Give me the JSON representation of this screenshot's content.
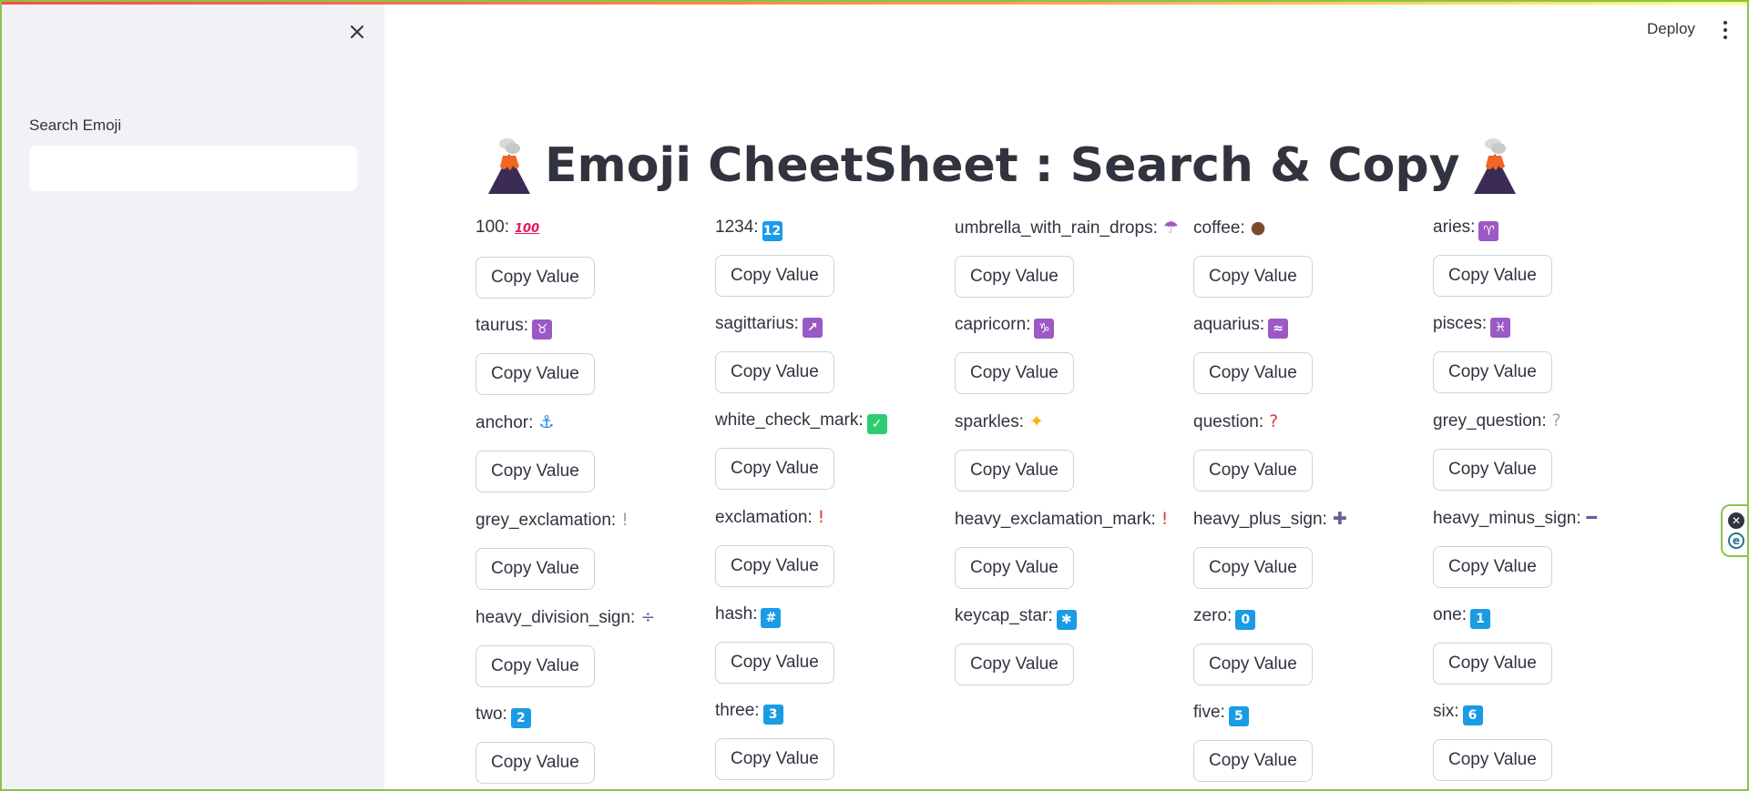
{
  "sidebar": {
    "search_label": "Search Emoji",
    "search_value": "",
    "search_placeholder": ""
  },
  "header": {
    "deploy_label": "Deploy"
  },
  "title": {
    "text": "Emoji CheetSheet : Search & Copy",
    "icon": "volcano-icon"
  },
  "copy_label": "Copy Value",
  "columns": [
    [
      {
        "name": "100:",
        "emoji": "💯",
        "emoji_text": "100",
        "icon": "hundred-points-icon",
        "color": "#e8175d",
        "style": "text"
      },
      {
        "name": "taurus:",
        "emoji": "♉",
        "emoji_text": "♉",
        "icon": "taurus-icon",
        "color": "#9b59c6",
        "style": "box"
      },
      {
        "name": "anchor:",
        "emoji": "⚓",
        "emoji_text": "⚓",
        "icon": "anchor-icon",
        "color": "#1e88e5",
        "style": "plain"
      },
      {
        "name": "grey_exclamation:",
        "emoji": "❕",
        "emoji_text": "!",
        "icon": "grey-exclamation-icon",
        "color": "#a0a4ab",
        "style": "plain"
      },
      {
        "name": "heavy_division_sign:",
        "emoji": "➗",
        "emoji_text": "÷",
        "icon": "division-sign-icon",
        "color": "#6a5b9a",
        "style": "plain"
      },
      {
        "name": "two:",
        "emoji": "2️⃣",
        "emoji_text": "2",
        "icon": "keycap-two-icon",
        "color": "#1a9be6",
        "style": "box"
      }
    ],
    [
      {
        "name": "1234:",
        "emoji": "🔢",
        "emoji_text": "12",
        "icon": "input-numbers-icon",
        "color": "#1a9be6",
        "style": "box"
      },
      {
        "name": "sagittarius:",
        "emoji": "♐",
        "emoji_text": "↗",
        "icon": "sagittarius-icon",
        "color": "#9b59c6",
        "style": "box"
      },
      {
        "name": "white_check_mark:",
        "emoji": "✅",
        "emoji_text": "✓",
        "icon": "check-mark-icon",
        "color": "#2ecc71",
        "style": "box"
      },
      {
        "name": "exclamation:",
        "emoji": "❗",
        "emoji_text": "!",
        "icon": "exclamation-icon",
        "color": "#e53935",
        "style": "plain"
      },
      {
        "name": "hash:",
        "emoji": "#️⃣",
        "emoji_text": "#",
        "icon": "keycap-hash-icon",
        "color": "#1a9be6",
        "style": "box"
      },
      {
        "name": "three:",
        "emoji": "3️⃣",
        "emoji_text": "3",
        "icon": "keycap-three-icon",
        "color": "#1a9be6",
        "style": "box"
      }
    ],
    [
      {
        "name": "umbrella_with_rain_drops:",
        "emoji": "☔",
        "emoji_text": "☂",
        "icon": "umbrella-rain-icon",
        "color": "#9b59c6",
        "style": "plain"
      },
      {
        "name": "capricorn:",
        "emoji": "♑",
        "emoji_text": "♑",
        "icon": "capricorn-icon",
        "color": "#9b59c6",
        "style": "box"
      },
      {
        "name": "sparkles:",
        "emoji": "✨",
        "emoji_text": "✦",
        "icon": "sparkles-icon",
        "color": "#f5b400",
        "style": "plain"
      },
      {
        "name": "heavy_exclamation_mark:",
        "emoji": "❗",
        "emoji_text": "!",
        "icon": "heavy-exclamation-icon",
        "color": "#e53935",
        "style": "plain"
      },
      {
        "name": "keycap_star:",
        "emoji": "*️⃣",
        "emoji_text": "✱",
        "icon": "keycap-star-icon",
        "color": "#1a9be6",
        "style": "box"
      }
    ],
    [
      {
        "name": "coffee:",
        "emoji": "☕",
        "emoji_text": "●",
        "icon": "coffee-icon",
        "color": "#7b4a2d",
        "style": "plain"
      },
      {
        "name": "aquarius:",
        "emoji": "♒",
        "emoji_text": "≈",
        "icon": "aquarius-icon",
        "color": "#9b59c6",
        "style": "box"
      },
      {
        "name": "question:",
        "emoji": "❓",
        "emoji_text": "?",
        "icon": "question-icon",
        "color": "#e53935",
        "style": "plain"
      },
      {
        "name": "heavy_plus_sign:",
        "emoji": "➕",
        "emoji_text": "✚",
        "icon": "plus-sign-icon",
        "color": "#6a5b9a",
        "style": "plain"
      },
      {
        "name": "zero:",
        "emoji": "0️⃣",
        "emoji_text": "0",
        "icon": "keycap-zero-icon",
        "color": "#1a9be6",
        "style": "box"
      },
      {
        "name": "five:",
        "emoji": "5️⃣",
        "emoji_text": "5",
        "icon": "keycap-five-icon",
        "color": "#1a9be6",
        "style": "box"
      }
    ],
    [
      {
        "name": "aries:",
        "emoji": "♈",
        "emoji_text": "♈",
        "icon": "aries-icon",
        "color": "#9b59c6",
        "style": "box"
      },
      {
        "name": "pisces:",
        "emoji": "♓",
        "emoji_text": "♓",
        "icon": "pisces-icon",
        "color": "#9b59c6",
        "style": "box"
      },
      {
        "name": "grey_question:",
        "emoji": "❔",
        "emoji_text": "?",
        "icon": "grey-question-icon",
        "color": "#a0a4ab",
        "style": "plain"
      },
      {
        "name": "heavy_minus_sign:",
        "emoji": "➖",
        "emoji_text": "━",
        "icon": "minus-sign-icon",
        "color": "#6a5b9a",
        "style": "plain"
      },
      {
        "name": "one:",
        "emoji": "1️⃣",
        "emoji_text": "1",
        "icon": "keycap-one-icon",
        "color": "#1a9be6",
        "style": "box"
      },
      {
        "name": "six:",
        "emoji": "6️⃣",
        "emoji_text": "6",
        "icon": "keycap-six-icon",
        "color": "#1a9be6",
        "style": "box"
      }
    ]
  ]
}
